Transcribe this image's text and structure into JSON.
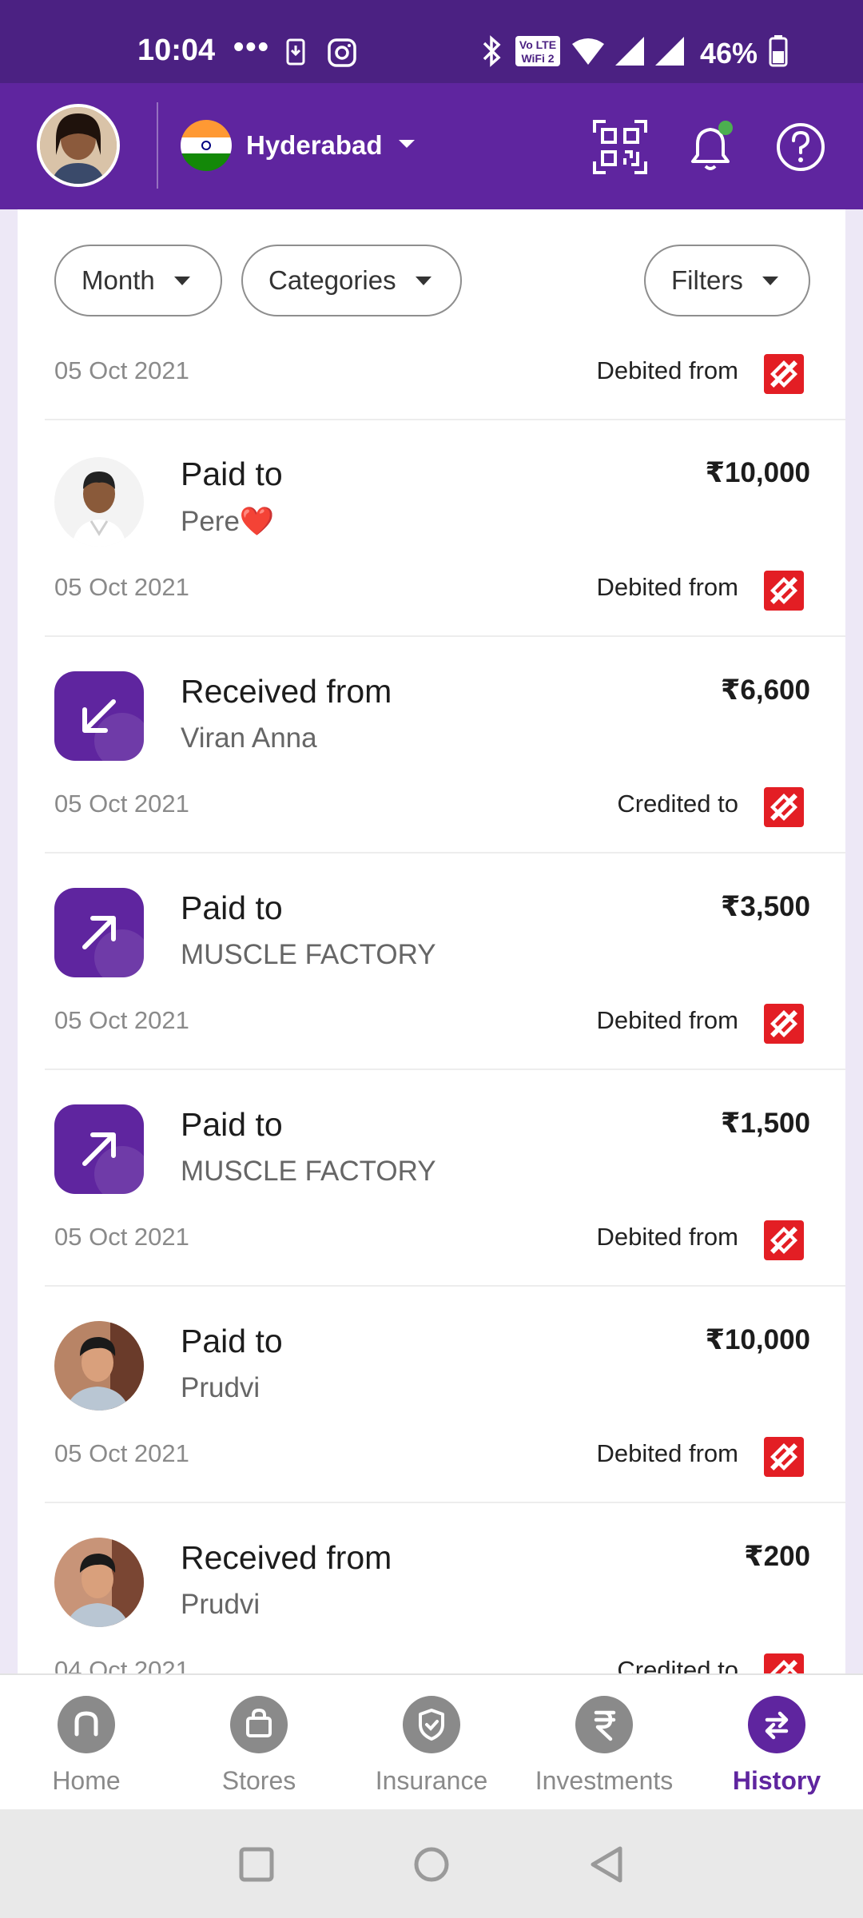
{
  "status_bar": {
    "time": "10:04",
    "dots": "•••",
    "battery": "46%"
  },
  "header": {
    "city": "Hyderabad",
    "icons": [
      "qr-code-icon",
      "notification-bell-icon",
      "help-icon"
    ]
  },
  "filters": {
    "month": "Month",
    "categories": "Categories",
    "filters": "Filters"
  },
  "transactions": [
    {
      "title": "",
      "name": "",
      "amount": "",
      "date": "05 Oct 2021",
      "via": "Debited from",
      "icon": "partial"
    },
    {
      "title": "Paid to",
      "name": "Pere❤️",
      "amount": "₹10,000",
      "date": "05 Oct 2021",
      "via": "Debited from",
      "icon": "photo"
    },
    {
      "title": "Received from",
      "name": "Viran Anna",
      "amount": "₹6,600",
      "date": "05 Oct 2021",
      "via": "Credited to",
      "icon": "arrow-received-icon"
    },
    {
      "title": "Paid to",
      "name": "MUSCLE FACTORY",
      "amount": "₹3,500",
      "date": "05 Oct 2021",
      "via": "Debited from",
      "icon": "arrow-paid-icon"
    },
    {
      "title": "Paid to",
      "name": "MUSCLE FACTORY",
      "amount": "₹1,500",
      "date": "05 Oct 2021",
      "via": "Debited from",
      "icon": "arrow-paid-icon"
    },
    {
      "title": "Paid to",
      "name": "Prudvi",
      "amount": "₹10,000",
      "date": "05 Oct 2021",
      "via": "Debited from",
      "icon": "photo"
    },
    {
      "title": "Received from",
      "name": "Prudvi",
      "amount": "₹200",
      "date": "04 Oct 2021",
      "via": "Credited to",
      "icon": "photo"
    }
  ],
  "bottom_nav": [
    {
      "label": "Home",
      "icon": "home-icon",
      "active": false
    },
    {
      "label": "Stores",
      "icon": "shopping-bag-icon",
      "active": false
    },
    {
      "label": "Insurance",
      "icon": "shield-icon",
      "active": false
    },
    {
      "label": "Investments",
      "icon": "rupee-icon",
      "active": false
    },
    {
      "label": "History",
      "icon": "swap-arrows-icon",
      "active": true
    }
  ],
  "colors": {
    "brand": "#5f259f",
    "status_bar": "#4b2182",
    "bank_logo": "#e31e24"
  }
}
